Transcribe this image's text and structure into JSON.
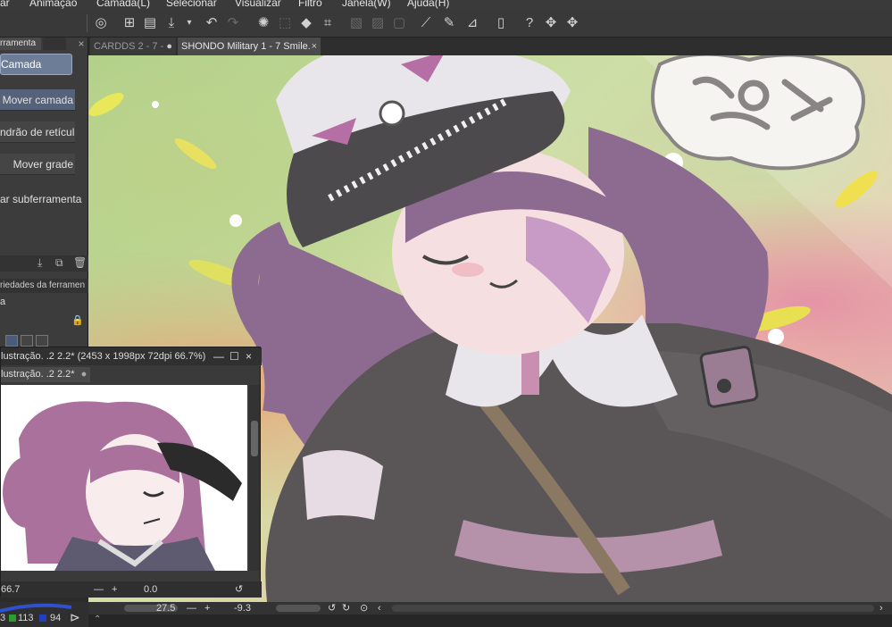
{
  "menu": [
    "ar",
    "Animação",
    "Camada(L)",
    "Selecionar",
    "Visualizar",
    "Filtro",
    "Janela(W)",
    "Ajuda(H)"
  ],
  "left_panel": {
    "tab_label": "rramenta",
    "selected": "Camada",
    "items": [
      "Mover camada",
      "ndrão de retículas",
      "Mover grade"
    ],
    "sub_label": "ar subferramenta",
    "properties_header": "riedades da ferramen",
    "properties_value": "a"
  },
  "tabs": [
    {
      "label": "CARDDS 2 - 7 -",
      "marker": "●"
    },
    {
      "label": "SHONDO Military 1 - 7 Smile.",
      "marker": "×"
    }
  ],
  "subwindow": {
    "title": "lustração. .2 2.2* (2453 x 1998px 72dpi 66.7%)",
    "tab_label": "lustração. .2 2.2*",
    "tab_dot": "●",
    "zoom": "66.7",
    "angle": "0.0"
  },
  "bottom_bar": {
    "zoom": "27.5",
    "angle": "-9.3"
  },
  "color_values": {
    "g": "113",
    "b": "94",
    "r_partial": "3"
  },
  "icons": {
    "minimize": "—",
    "maximize": "☐",
    "close": "×",
    "undo": "↶",
    "redo": "↷"
  }
}
